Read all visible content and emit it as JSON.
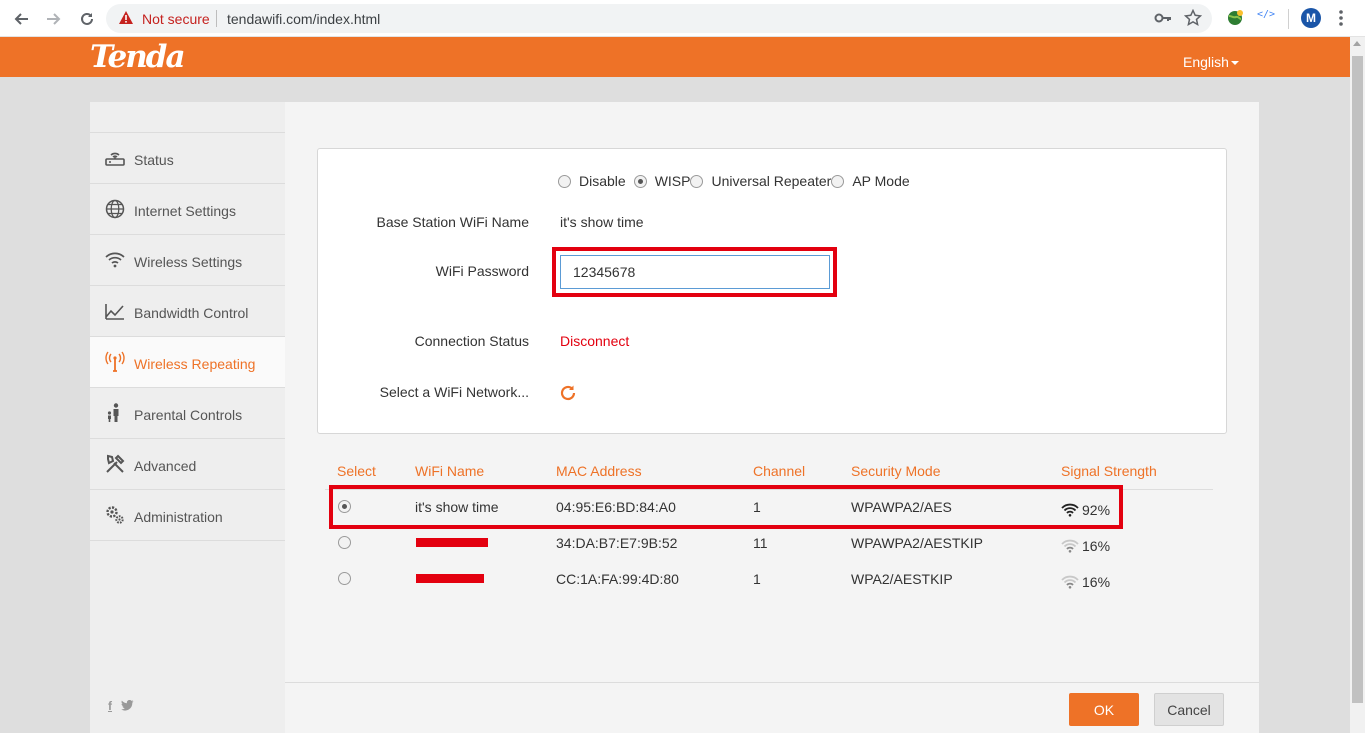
{
  "browser": {
    "security_label": "Not secure",
    "url": "tendawifi.com/index.html",
    "profile_initial": "M",
    "devtools_ext_label": "</>"
  },
  "header": {
    "logo": "Tenda",
    "language": "English"
  },
  "sidebar": {
    "items": [
      {
        "label": "Status",
        "icon": "router-icon",
        "active": false
      },
      {
        "label": "Internet Settings",
        "icon": "globe-icon",
        "active": false
      },
      {
        "label": "Wireless Settings",
        "icon": "wifi-icon",
        "active": false
      },
      {
        "label": "Bandwidth Control",
        "icon": "bandwidth-icon",
        "active": false
      },
      {
        "label": "Wireless Repeating",
        "icon": "antenna-icon",
        "active": true
      },
      {
        "label": "Parental Controls",
        "icon": "parental-icon",
        "active": false
      },
      {
        "label": "Advanced",
        "icon": "tools-icon",
        "active": false
      },
      {
        "label": "Administration",
        "icon": "gears-icon",
        "active": false
      }
    ],
    "social": [
      "f",
      "twitter"
    ]
  },
  "mode": {
    "options": [
      "Disable",
      "WISP",
      "Universal Repeater",
      "AP Mode"
    ],
    "selected": "WISP"
  },
  "form": {
    "base_station_label": "Base Station WiFi Name",
    "base_station_value": "it's show time",
    "password_label": "WiFi Password",
    "password_value": "12345678",
    "connection_label": "Connection Status",
    "connection_value": "Disconnect",
    "select_network_label": "Select a WiFi Network..."
  },
  "table": {
    "headers": [
      "Select",
      "WiFi Name",
      "MAC Address",
      "Channel",
      "Security Mode",
      "Signal Strength"
    ],
    "rows": [
      {
        "selected": true,
        "name": "it's show time",
        "redacted": false,
        "mac": "04:95:E6:BD:84:A0",
        "channel": "1",
        "security": "WPAWPA2/AES",
        "signal": "92%"
      },
      {
        "selected": false,
        "name": "",
        "redacted": true,
        "mac": "34:DA:B7:E7:9B:52",
        "channel": "11",
        "security": "WPAWPA2/AESTKIP",
        "signal": "16%"
      },
      {
        "selected": false,
        "name": "",
        "redacted": true,
        "mac": "CC:1A:FA:99:4D:80",
        "channel": "1",
        "security": "WPA2/AESTKIP",
        "signal": "16%"
      }
    ]
  },
  "buttons": {
    "ok": "OK",
    "cancel": "Cancel"
  },
  "colors": {
    "brand": "#ee7227",
    "highlight": "#e3000f"
  }
}
